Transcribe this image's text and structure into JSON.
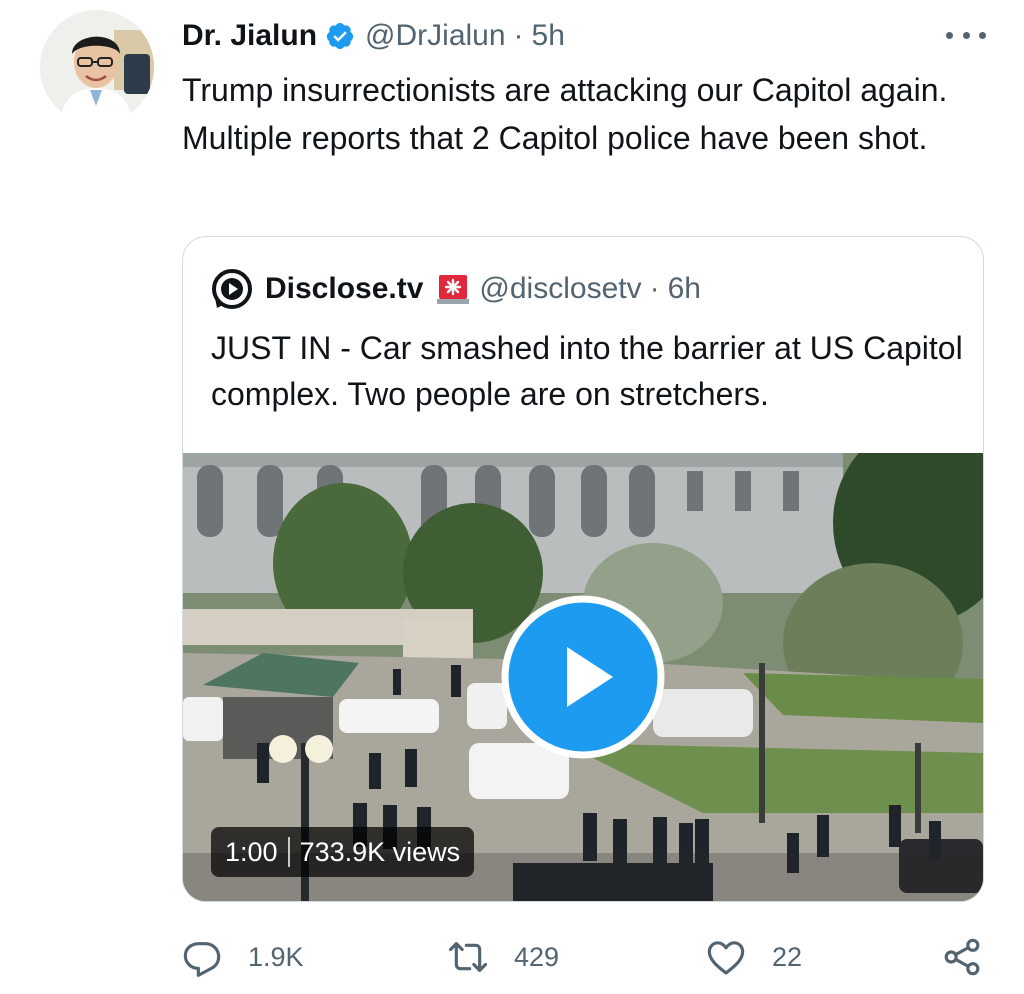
{
  "tweet": {
    "author": {
      "display_name": "Dr. Jialun",
      "handle": "@DrJialun",
      "verified_icon": "verified-badge-icon",
      "avatar": "avatar-photo"
    },
    "separator": "·",
    "time": "5h",
    "text": "Trump insurrectionists are attacking our Capitol again. Multiple reports that 2 Capitol police have been shot.",
    "more_icon": "more-horizontal-icon"
  },
  "quoted_tweet": {
    "author": {
      "display_name": "Disclose.tv",
      "handle": "@disclosetv",
      "badge_icon": "siren-emoji-icon",
      "avatar": "disclosetv-logo"
    },
    "separator": "·",
    "time": "6h",
    "text": "JUST IN - Car smashed into the barrier at US Capitol complex. Two people are on stretchers.",
    "media": {
      "type": "video",
      "duration": "1:00",
      "views": "733.9K views",
      "play_icon": "play-icon"
    }
  },
  "actions": {
    "reply": {
      "icon": "reply-icon",
      "count": "1.9K"
    },
    "retweet": {
      "icon": "retweet-icon",
      "count": "429"
    },
    "like": {
      "icon": "heart-icon",
      "count": "22"
    },
    "share": {
      "icon": "share-icon"
    }
  },
  "colors": {
    "primary_text": "#0f1419",
    "secondary_text": "#536471",
    "accent_blue": "#1d9bf0",
    "border": "#cfd9de"
  }
}
